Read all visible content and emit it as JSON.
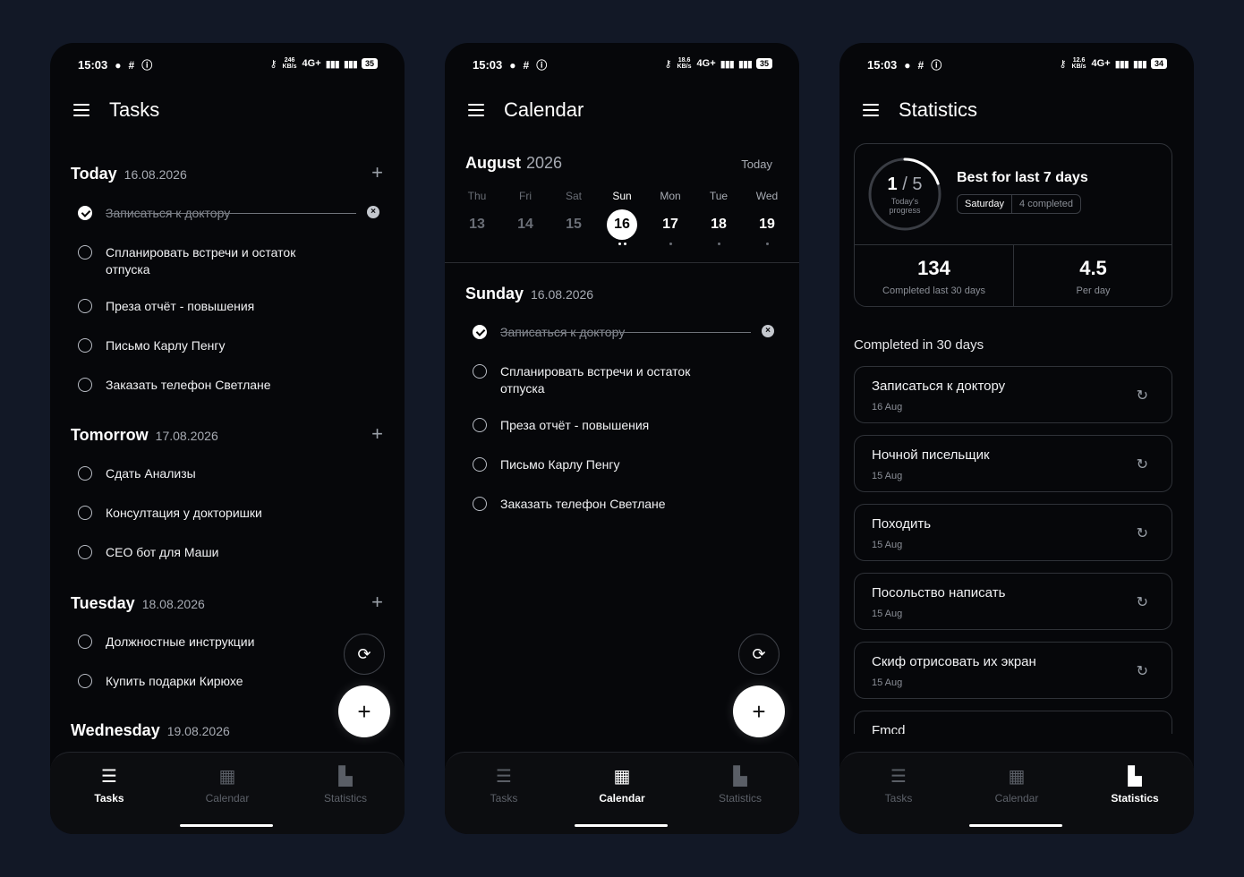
{
  "status_bar": {
    "time": "15:03",
    "network": "4G+",
    "speed_tasks": "246 KB/s",
    "speed_calendar": "18.6 KB/s",
    "speed_stats": "12.6 KB/s",
    "battery_tasks": "35",
    "battery_calendar": "35",
    "battery_stats": "34"
  },
  "nav": {
    "tasks": "Tasks",
    "calendar": "Calendar",
    "statistics": "Statistics"
  },
  "tasks_screen": {
    "title": "Tasks",
    "sections": [
      {
        "name": "Today",
        "date": "16.08.2026",
        "items": [
          {
            "text": "Записаться к доктору",
            "done": true
          },
          {
            "text": "Спланировать встречи и остаток отпуска",
            "done": false
          },
          {
            "text": "Преза отчёт - повышения",
            "done": false
          },
          {
            "text": "Письмо Карлу Пенгу",
            "done": false
          },
          {
            "text": "Заказать телефон Светлане",
            "done": false
          }
        ]
      },
      {
        "name": "Tomorrow",
        "date": "17.08.2026",
        "items": [
          {
            "text": "Сдать Анализы",
            "done": false
          },
          {
            "text": "Консултация у докторишки",
            "done": false
          },
          {
            "text": "СЕО бот для Маши",
            "done": false
          }
        ]
      },
      {
        "name": "Tuesday",
        "date": "18.08.2026",
        "items": [
          {
            "text": "Должностные инструкции",
            "done": false
          },
          {
            "text": "Купить подарки Кирюхе",
            "done": false
          }
        ]
      },
      {
        "name": "Wednesday",
        "date": "19.08.2026",
        "items": []
      }
    ]
  },
  "calendar_screen": {
    "title": "Calendar",
    "month": "August",
    "year": "2026",
    "today_label": "Today",
    "week": [
      {
        "name": "Thu",
        "num": "13",
        "dots": 0
      },
      {
        "name": "Fri",
        "num": "14",
        "dots": 0
      },
      {
        "name": "Sat",
        "num": "15",
        "dots": 0
      },
      {
        "name": "Sun",
        "num": "16",
        "dots": 2
      },
      {
        "name": "Mon",
        "num": "17",
        "dots": 1
      },
      {
        "name": "Tue",
        "num": "18",
        "dots": 1
      },
      {
        "name": "Wed",
        "num": "19",
        "dots": 1
      }
    ],
    "selected_day": {
      "name": "Sunday",
      "date": "16.08.2026"
    },
    "items": [
      {
        "text": "Записаться к доктору",
        "done": true
      },
      {
        "text": "Спланировать встречи и остаток отпуска",
        "done": false
      },
      {
        "text": "Преза отчёт - повышения",
        "done": false
      },
      {
        "text": "Письмо Карлу Пенгу",
        "done": false
      },
      {
        "text": "Заказать телефон Светлане",
        "done": false
      }
    ]
  },
  "stats_screen": {
    "title": "Statistics",
    "progress_done": "1",
    "progress_total": "5",
    "progress_label": "Today's progress",
    "progress_fraction": 0.2,
    "best_title": "Best for last 7 days",
    "best_day": "Saturday",
    "best_count": "4 completed",
    "completed_30": "134",
    "completed_30_label": "Completed last 30 days",
    "per_day": "4.5",
    "per_day_label": "Per day",
    "completed_head": "Completed in 30 days",
    "completed": [
      {
        "title": "Записаться к доктору",
        "date": "16 Aug"
      },
      {
        "title": "Ночной писельщик",
        "date": "15 Aug"
      },
      {
        "title": "Походить",
        "date": "15 Aug"
      },
      {
        "title": "Посольство написать",
        "date": "15 Aug"
      },
      {
        "title": "Скиф отрисовать их экран",
        "date": "15 Aug"
      },
      {
        "title": "Fmcd",
        "date": ""
      }
    ]
  },
  "colors": {
    "page_bg": "#121826",
    "screen_bg": "#06070a",
    "accent": "#ffffff",
    "muted": "#8a8e96"
  }
}
